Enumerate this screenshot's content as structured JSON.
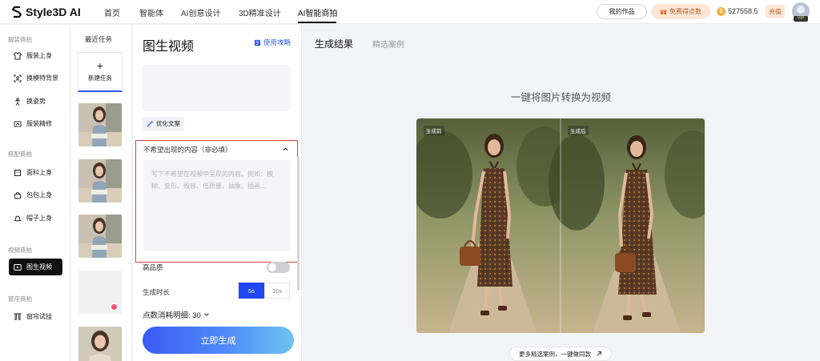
{
  "brand": {
    "logo_text": "Style3D AI"
  },
  "topnav": {
    "items": [
      "首页",
      "智能体",
      "AI创意设计",
      "3D精准设计",
      "AI智能商拍"
    ],
    "active_index": 4,
    "my_works": "我的作品",
    "free_points": "免费得点数",
    "balance": "527558.5",
    "recharge": "充值",
    "vip": "VIP"
  },
  "sidebar": {
    "groups": [
      {
        "title": "服装商拍",
        "items": [
          "服装上身",
          "换模特背景",
          "换姿势",
          "服装精修"
        ]
      },
      {
        "title": "搭配商拍",
        "items": [
          "面料上身",
          "包包上身",
          "帽子上身"
        ]
      },
      {
        "title": "视频商拍",
        "items": [
          "图生视频"
        ]
      },
      {
        "title": "窗帘商拍",
        "items": [
          "窗帘试挂"
        ]
      }
    ],
    "active_item": "图生视频"
  },
  "tasks": {
    "title": "最近任务",
    "new_task_label": "新建任务"
  },
  "panel": {
    "title": "图生视频",
    "guide_link": "使用攻略",
    "optimize_label": "优化文案",
    "negative": {
      "label": "不希望出现的内容（非必填）",
      "placeholder": "写下不希望在视频中呈现的内容。例如：模糊、变形、毁容、低质量、抽象、插画…"
    },
    "high_quality_label": "高品质",
    "high_quality_on": false,
    "duration_label": "生成时长",
    "duration_options": [
      "5s",
      "10s"
    ],
    "duration_selected": "5s",
    "cost_label": "点数消耗明细: 30",
    "generate_button": "立即生成"
  },
  "result": {
    "tabs": [
      "生成结果",
      "精选案例"
    ],
    "active_tab": "生成结果",
    "headline": "一键将图片转换为视频",
    "before_label": "生成前",
    "after_label": "生成后",
    "more_cases": "更多精选案例，一键做同款"
  },
  "colors": {
    "accent_blue": "#1f47f2",
    "highlight_red": "#e23b3b",
    "sidebar_active": "#111111"
  }
}
